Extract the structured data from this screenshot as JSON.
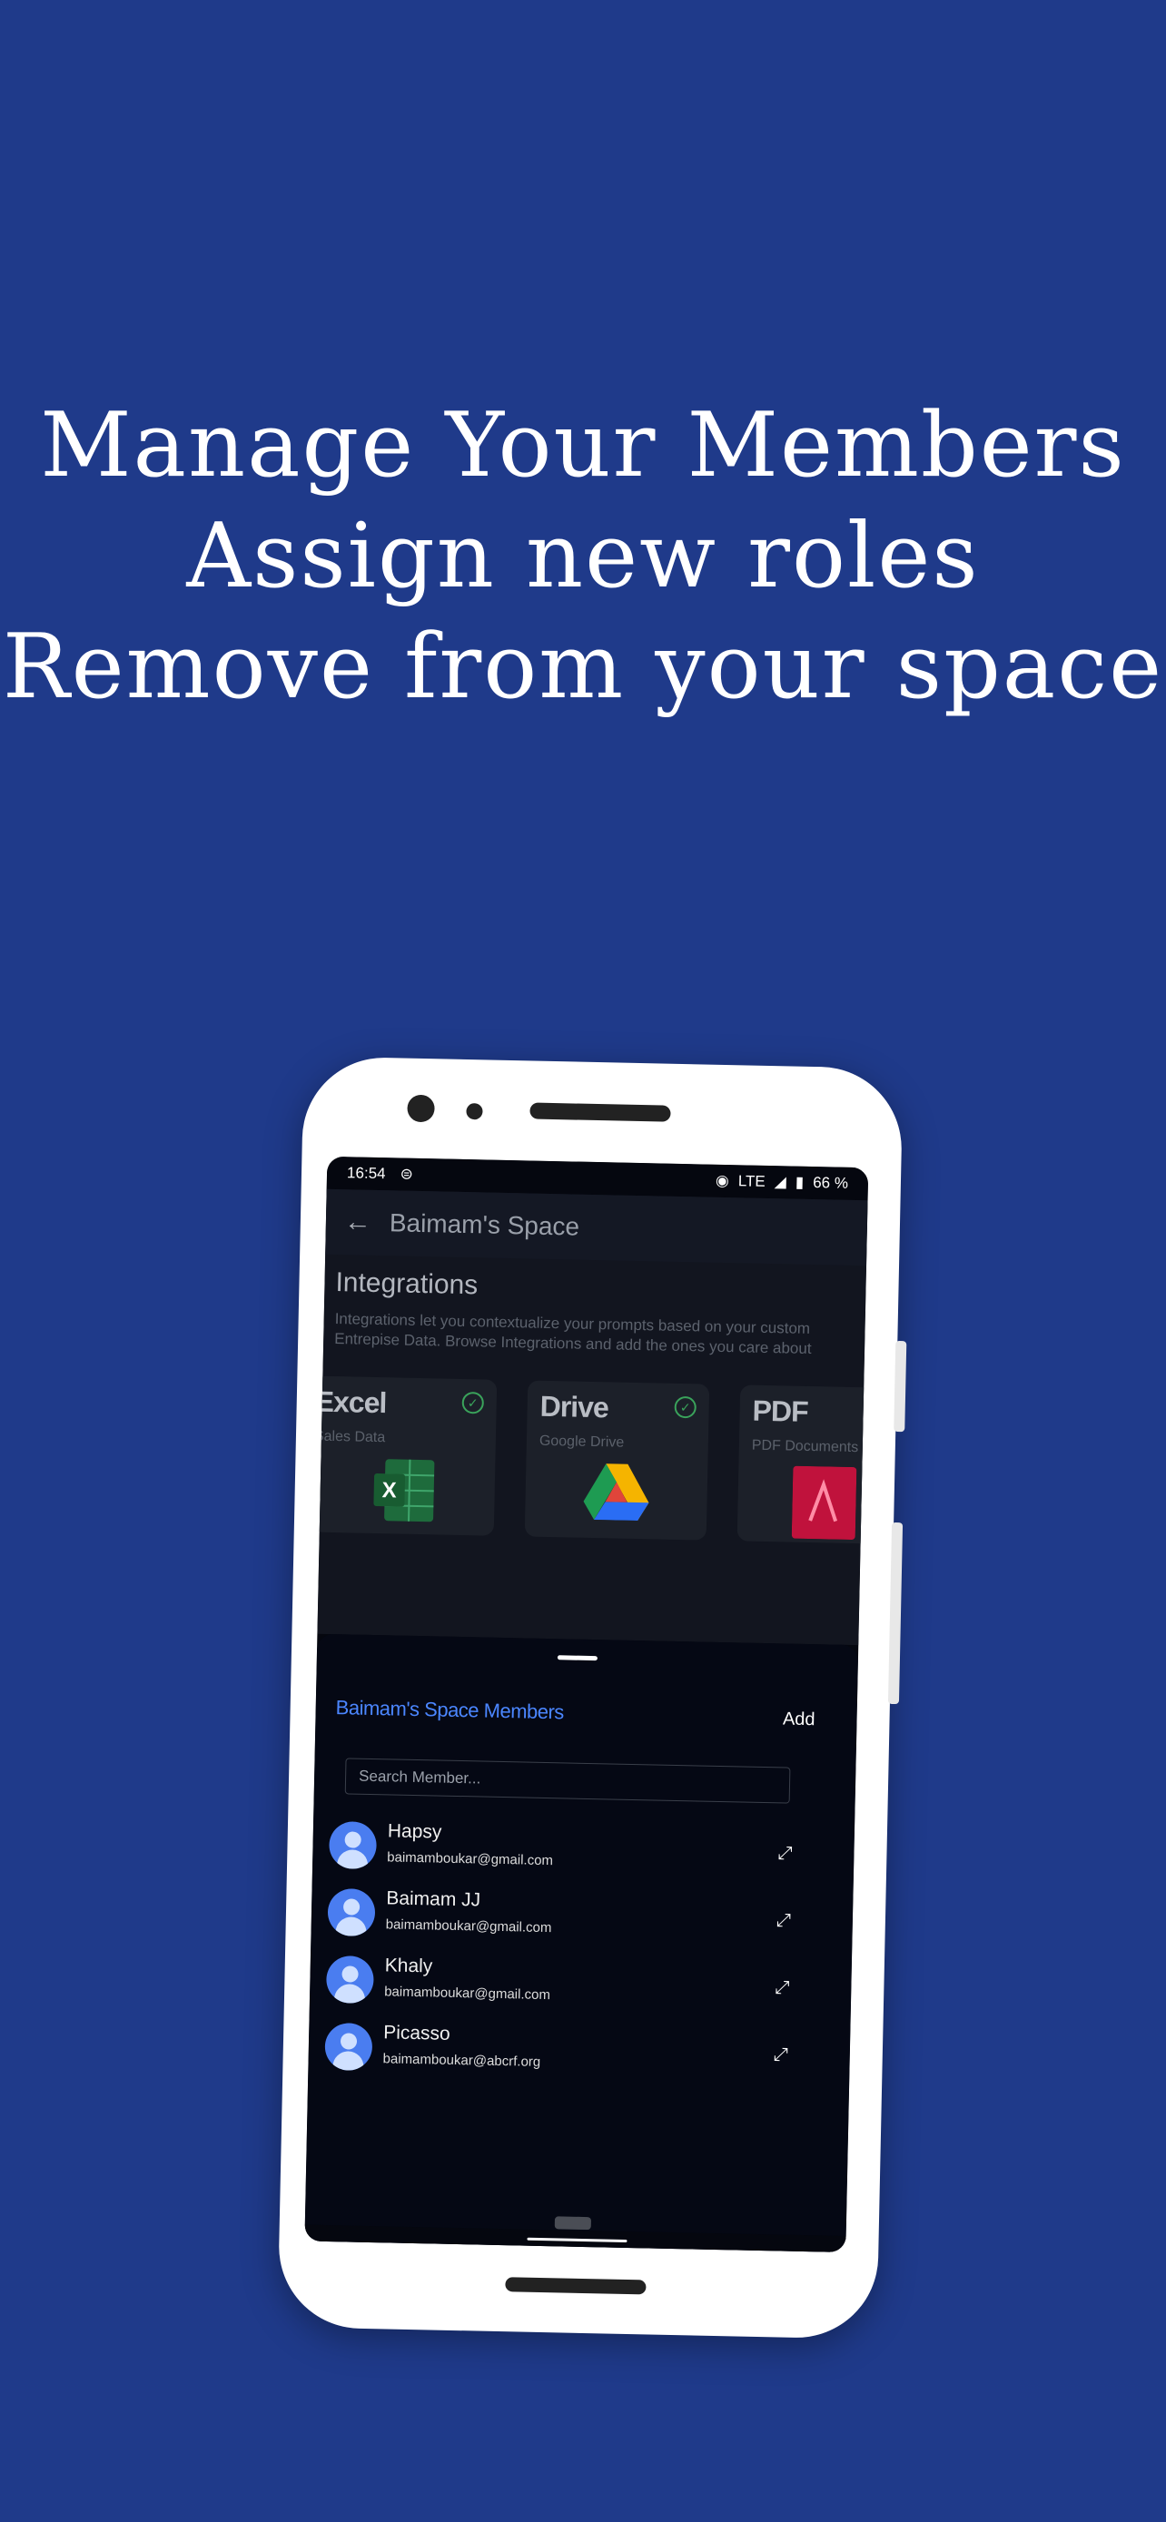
{
  "headline": {
    "line1": "Manage Your Members",
    "line2": "Assign new roles",
    "line3": "Remove from your space"
  },
  "status_bar": {
    "time": "16:54",
    "network": "LTE",
    "battery": "66 %"
  },
  "app_bar": {
    "back_icon": "arrow-left-icon",
    "title": "Baimam's Space"
  },
  "integrations": {
    "title": "Integrations",
    "description": "Integrations let you contextualize your prompts based on your custom Entrepise Data. Browse Integrations and add the ones you care about",
    "cards": [
      {
        "name": "Excel",
        "subtitle": "Sales Data",
        "connected": true,
        "icon": "excel-icon"
      },
      {
        "name": "Drive",
        "subtitle": "Google Drive",
        "connected": true,
        "icon": "google-drive-icon"
      },
      {
        "name": "PDF",
        "subtitle": "PDF Documents",
        "connected": false,
        "icon": "pdf-icon"
      }
    ]
  },
  "members_sheet": {
    "title": "Baimam's Space Members",
    "add_label": "Add",
    "search_placeholder": "Search Member...",
    "members": [
      {
        "name": "Hapsy",
        "email": "baimamboukar@gmail.com"
      },
      {
        "name": "Baimam JJ",
        "email": "baimamboukar@gmail.com"
      },
      {
        "name": "Khaly",
        "email": "baimamboukar@gmail.com"
      },
      {
        "name": "Picasso",
        "email": "baimamboukar@abcrf.org"
      }
    ]
  },
  "colors": {
    "background": "#1f3a8a",
    "accent": "#4b86ff",
    "check": "#3aa35b"
  }
}
